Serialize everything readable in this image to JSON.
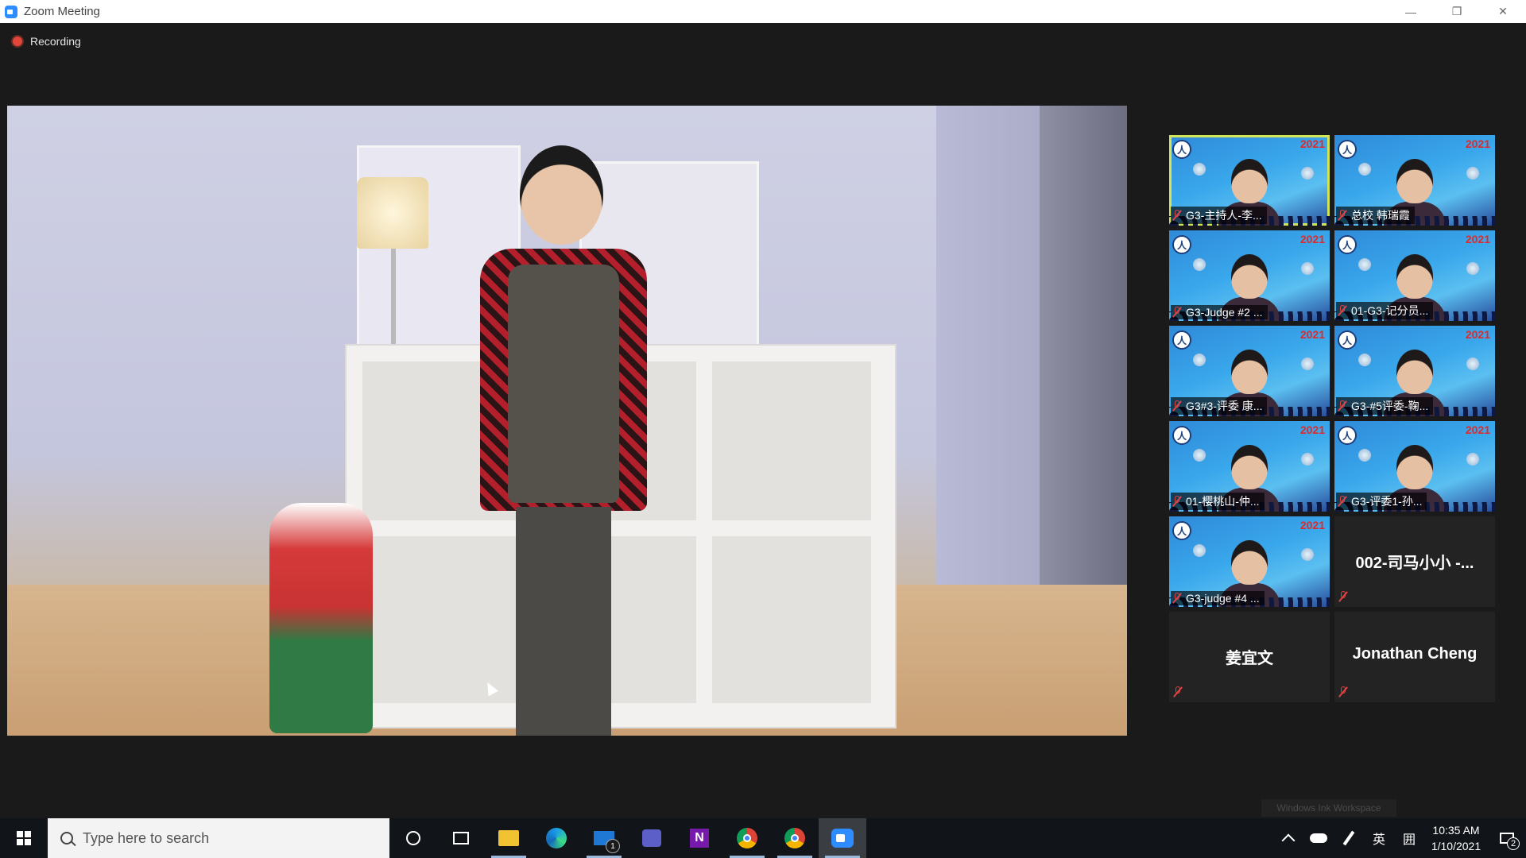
{
  "window": {
    "title": "Zoom Meeting",
    "controls": {
      "minimize": "—",
      "restore": "❐",
      "close": "✕"
    }
  },
  "recording": {
    "label": "Recording"
  },
  "gallery": {
    "tiles": [
      {
        "name": "G3-主持人-李...",
        "type": "video",
        "active": true
      },
      {
        "name": "总校 韩瑞霞",
        "type": "video",
        "active": false
      },
      {
        "name": "G3-Judge #2 ...",
        "type": "video",
        "active": false
      },
      {
        "name": "01-G3-记分员...",
        "type": "video",
        "active": false
      },
      {
        "name": "G3#3-评委 康...",
        "type": "video",
        "active": false
      },
      {
        "name": "G3-#5评委-鞠...",
        "type": "video",
        "active": false
      },
      {
        "name": "01-樱桃山-仲...",
        "type": "video",
        "active": false
      },
      {
        "name": "G3-评委1-孙...",
        "type": "video",
        "active": false
      },
      {
        "name": "G3-judge #4 ...",
        "type": "video",
        "active": false
      },
      {
        "name": "002-司马小小 -...",
        "type": "name-only",
        "active": false
      },
      {
        "name": "姜宜文",
        "type": "name-only",
        "active": false
      },
      {
        "name": "Jonathan Cheng",
        "type": "name-only",
        "active": false
      }
    ],
    "year_badge": "2021"
  },
  "watermark": "Windows Ink Workspace",
  "taskbar": {
    "search_placeholder": "Type here to search",
    "mail_badge": "1",
    "onenote_letter": "N",
    "tray": {
      "ime_language": "英",
      "ime_mode": "囲",
      "time": "10:35 AM",
      "date": "1/10/2021",
      "notification_count": "2"
    }
  },
  "colors": {
    "active_speaker_outline": "#d2e55a",
    "recording_dot": "#e0463a",
    "zoom_blue": "#2d8cff",
    "mute_red": "#e04444"
  }
}
